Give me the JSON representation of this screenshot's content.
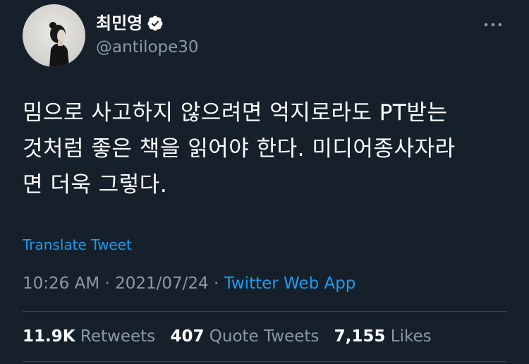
{
  "author": {
    "display_name": "최민영",
    "handle": "@antilope30",
    "verified": true
  },
  "tweet": {
    "text_line1": "밈으로 사고하지 않으려면 억지로라도 PT받는",
    "text_line2": "것처럼 좋은 책을 읽어야 한다. 미디어종사자라",
    "text_line3": "면 더욱 그렇다.",
    "translate_label": "Translate Tweet",
    "time": "10:26 AM",
    "separator": "·",
    "date": "2021/07/24",
    "source": "Twitter Web App"
  },
  "stats": {
    "retweets_count": "11.9K",
    "retweets_label": "Retweets",
    "quotes_count": "407",
    "quotes_label": "Quote Tweets",
    "likes_count": "7,155",
    "likes_label": "Likes"
  },
  "colors": {
    "background": "#15202b",
    "accent": "#1d9bf0",
    "muted": "#8b98a5",
    "divider": "#38444d"
  },
  "icons": {
    "more": "more-horizontal-icon",
    "verified": "verified-badge-icon"
  }
}
